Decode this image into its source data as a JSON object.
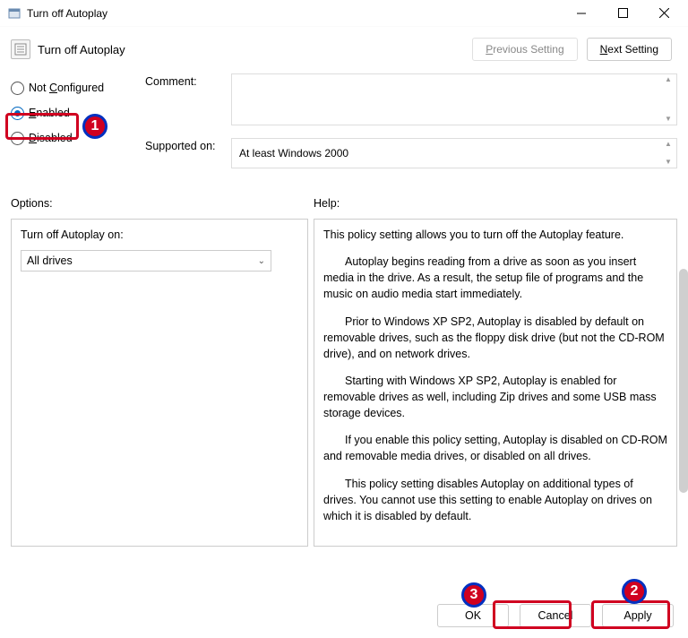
{
  "window": {
    "title": "Turn off Autoplay"
  },
  "header": {
    "title": "Turn off Autoplay",
    "prev_label": "Previous Setting",
    "next_label": "Next Setting"
  },
  "radios": {
    "not_configured": "Not Configured",
    "enabled": "Enabled",
    "disabled": "Disabled",
    "selected": "enabled"
  },
  "comment": {
    "label": "Comment:",
    "value": ""
  },
  "supported": {
    "label": "Supported on:",
    "value": "At least Windows 2000"
  },
  "sections": {
    "options": "Options:",
    "help": "Help:"
  },
  "options_panel": {
    "label": "Turn off Autoplay on:",
    "selected": "All drives",
    "choices": [
      "All drives"
    ]
  },
  "help": {
    "p1": "This policy setting allows you to turn off the Autoplay feature.",
    "p2": "Autoplay begins reading from a drive as soon as you insert media in the drive. As a result, the setup file of programs and the music on audio media start immediately.",
    "p3": "Prior to Windows XP SP2, Autoplay is disabled by default on removable drives, such as the floppy disk drive (but not the CD-ROM drive), and on network drives.",
    "p4": "Starting with Windows XP SP2, Autoplay is enabled for removable drives as well, including Zip drives and some USB mass storage devices.",
    "p5": "If you enable this policy setting, Autoplay is disabled on CD-ROM and removable media drives, or disabled on all drives.",
    "p6": "This policy setting disables Autoplay on additional types of drives. You cannot use this setting to enable Autoplay on drives on which it is disabled by default."
  },
  "buttons": {
    "ok": "OK",
    "cancel": "Cancel",
    "apply": "Apply"
  },
  "annotations": {
    "n1": "1",
    "n2": "2",
    "n3": "3"
  }
}
